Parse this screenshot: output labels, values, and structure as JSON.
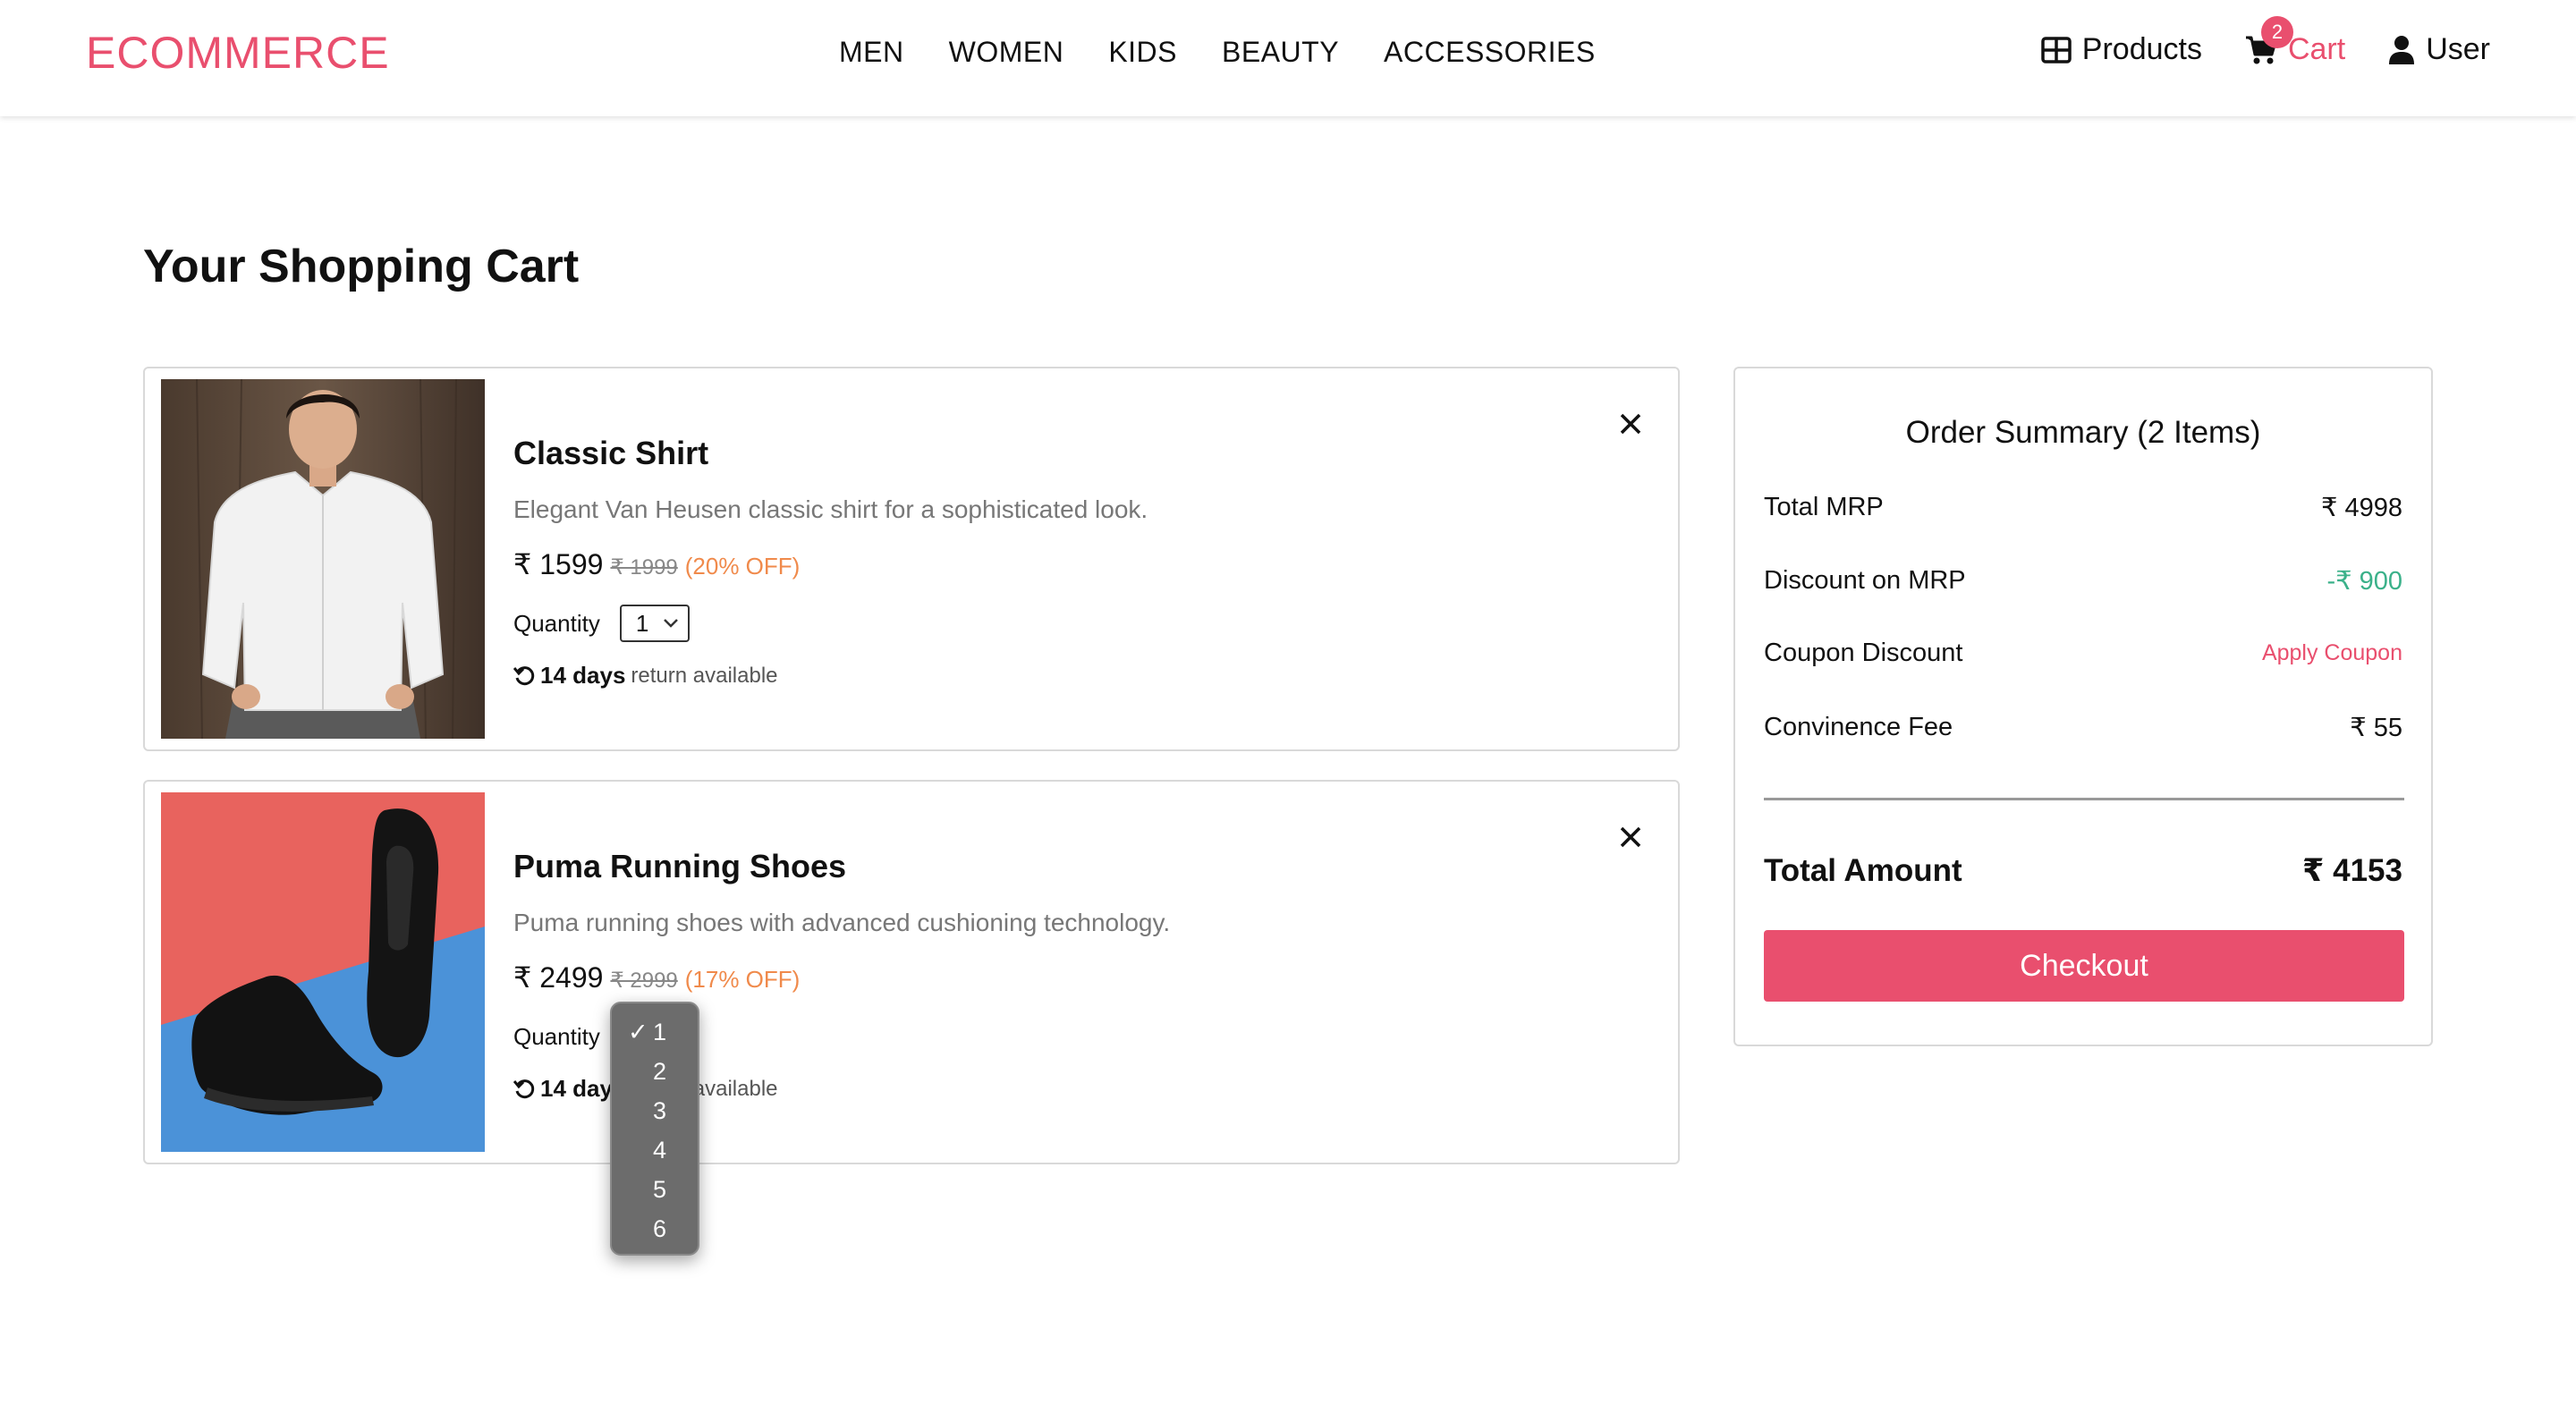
{
  "header": {
    "logo": "ECOMMERCE",
    "nav": [
      "MEN",
      "WOMEN",
      "KIDS",
      "BEAUTY",
      "ACCESSORIES"
    ],
    "products_label": "Products",
    "cart_label": "Cart",
    "cart_count": "2",
    "user_label": "User"
  },
  "page": {
    "title": "Your Shopping Cart"
  },
  "cart": {
    "items": [
      {
        "name": "Classic Shirt",
        "description": "Elegant Van Heusen classic shirt for a sophisticated look.",
        "price": "₹ 1599",
        "mrp": "₹ 1999",
        "discount": "(20% OFF)",
        "quantity_label": "Quantity",
        "quantity": "1",
        "return_days": "14 days",
        "return_text": "return available"
      },
      {
        "name": "Puma Running Shoes",
        "description": "Puma running shoes with advanced cushioning technology.",
        "price": "₹ 2499",
        "mrp": "₹ 2999",
        "discount": "(17% OFF)",
        "quantity_label": "Quantity",
        "quantity": "1",
        "return_days": "14 days",
        "return_text": "return available"
      }
    ],
    "quantity_options": [
      "1",
      "2",
      "3",
      "4",
      "5",
      "6"
    ],
    "selected_option": "1"
  },
  "summary": {
    "title": "Order Summary (2 Items)",
    "rows": [
      {
        "label": "Total MRP",
        "value": "₹ 4998"
      },
      {
        "label": "Discount on MRP",
        "value": "-₹ 900"
      },
      {
        "label": "Coupon Discount",
        "value": "Apply Coupon"
      },
      {
        "label": "Convinence Fee",
        "value": "₹ 55"
      }
    ],
    "total_label": "Total Amount",
    "total_value": "₹ 4153",
    "checkout_label": "Checkout"
  },
  "colors": {
    "brand": "#e94f6e",
    "discount_green": "#3bb18a",
    "off_orange": "#f08a4b"
  },
  "icons": [
    "products-grid-icon",
    "cart-icon",
    "user-icon",
    "close-icon",
    "return-icon",
    "chevron-down-icon",
    "check-icon"
  ]
}
